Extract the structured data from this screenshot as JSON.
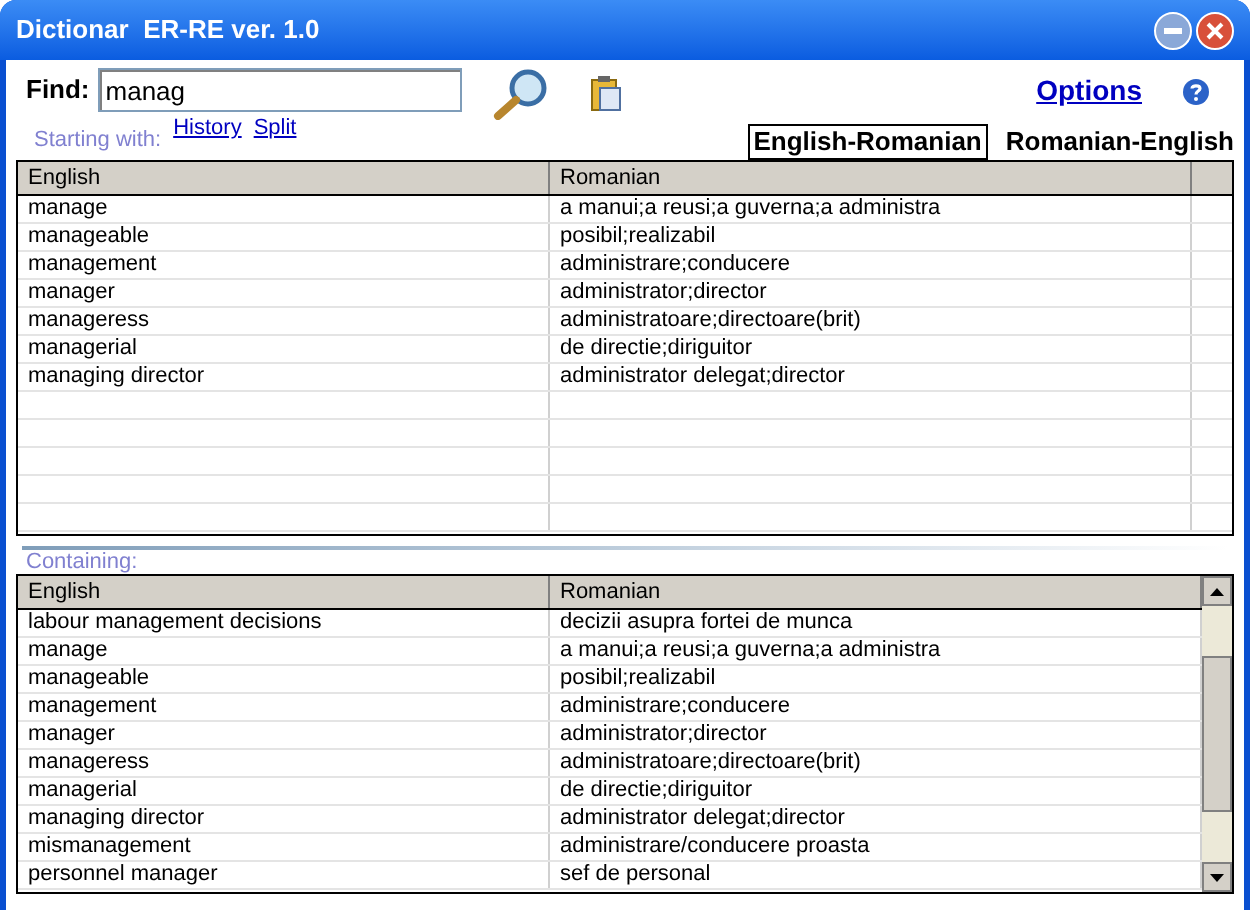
{
  "window": {
    "title": "Dictionar  ER-RE ver. 1.0"
  },
  "find": {
    "label": "Find:",
    "value": "manag"
  },
  "links": [
    {
      "label": "History"
    },
    {
      "label": "Split"
    }
  ],
  "options_link": "Options",
  "starting_with": "Starting with:",
  "directions": [
    {
      "label": "English-Romanian",
      "selected": true
    },
    {
      "label": "Romanian-English",
      "selected": false
    }
  ],
  "starting_table": {
    "columns": [
      "English",
      "Romanian"
    ],
    "rows": [
      [
        "manage",
        "a manui;a reusi;a guverna;a administra"
      ],
      [
        "manageable",
        "posibil;realizabil"
      ],
      [
        "management",
        "administrare;conducere"
      ],
      [
        "manager",
        "administrator;director"
      ],
      [
        "manageress",
        "administratoare;directoare(brit)"
      ],
      [
        "managerial",
        "de directie;diriguitor"
      ],
      [
        "managing director",
        "administrator delegat;director"
      ]
    ]
  },
  "containing_label": "Containing:",
  "containing_table": {
    "columns": [
      "English",
      "Romanian"
    ],
    "rows": [
      [
        "labour management decisions",
        "decizii asupra fortei de munca"
      ],
      [
        "manage",
        "a manui;a reusi;a guverna;a administra"
      ],
      [
        "manageable",
        "posibil;realizabil"
      ],
      [
        "management",
        "administrare;conducere"
      ],
      [
        "manager",
        "administrator;director"
      ],
      [
        "manageress",
        "administratoare;directoare(brit)"
      ],
      [
        "managerial",
        "de directie;diriguitor"
      ],
      [
        "managing director",
        "administrator delegat;director"
      ],
      [
        "mismanagement",
        "administrare/conducere proasta"
      ],
      [
        "personnel manager",
        "sef de personal"
      ]
    ]
  }
}
